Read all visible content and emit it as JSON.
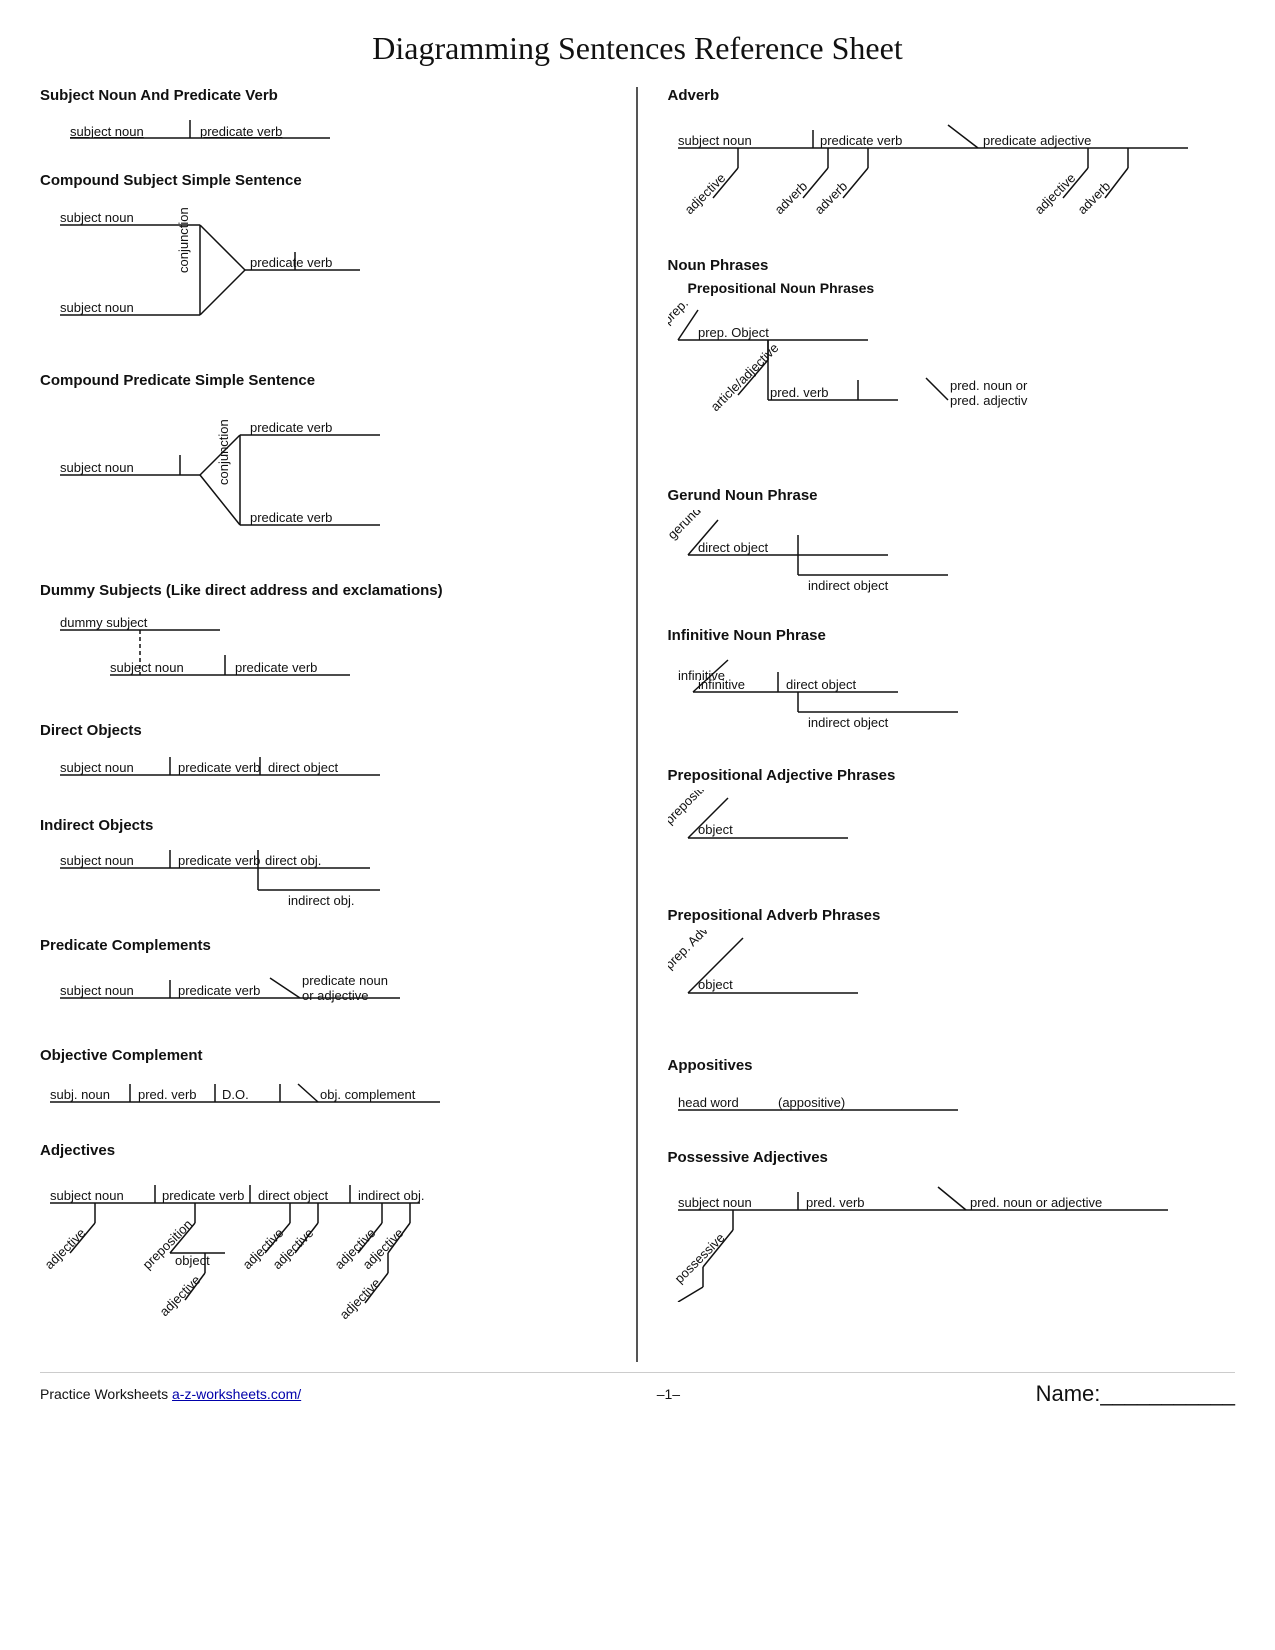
{
  "title": "Diagramming Sentences Reference Sheet",
  "left": {
    "sections": [
      {
        "id": "subject-predicate",
        "title": "Subject Noun And Predicate Verb"
      },
      {
        "id": "compound-subject",
        "title": "Compound Subject Simple Sentence"
      },
      {
        "id": "compound-predicate",
        "title": "Compound Predicate Simple Sentence"
      },
      {
        "id": "dummy-subjects",
        "title": "Dummy Subjects (Like direct address and exclamations)"
      },
      {
        "id": "direct-objects",
        "title": "Direct Objects"
      },
      {
        "id": "indirect-objects",
        "title": "Indirect Objects"
      },
      {
        "id": "predicate-complements",
        "title": "Predicate Complements"
      },
      {
        "id": "objective-complement",
        "title": "Objective Complement"
      },
      {
        "id": "adjectives",
        "title": "Adjectives"
      }
    ]
  },
  "right": {
    "sections": [
      {
        "id": "adverb",
        "title": "Adverb"
      },
      {
        "id": "noun-phrases",
        "title": "Noun Phrases"
      },
      {
        "id": "gerund",
        "title": "Gerund Noun Phrase"
      },
      {
        "id": "infinitive",
        "title": "Infinitive Noun Phrase"
      },
      {
        "id": "prep-adj",
        "title": "Prepositional Adjective Phrases"
      },
      {
        "id": "prep-adv",
        "title": "Prepositional Adverb Phrases"
      },
      {
        "id": "appositives",
        "title": "Appositives"
      },
      {
        "id": "possessive",
        "title": "Possessive Adjectives"
      }
    ]
  },
  "footer": {
    "practice": "Practice Worksheets",
    "link": "a-z-worksheets.com/",
    "page": "–1–",
    "name_label": "Name:"
  }
}
